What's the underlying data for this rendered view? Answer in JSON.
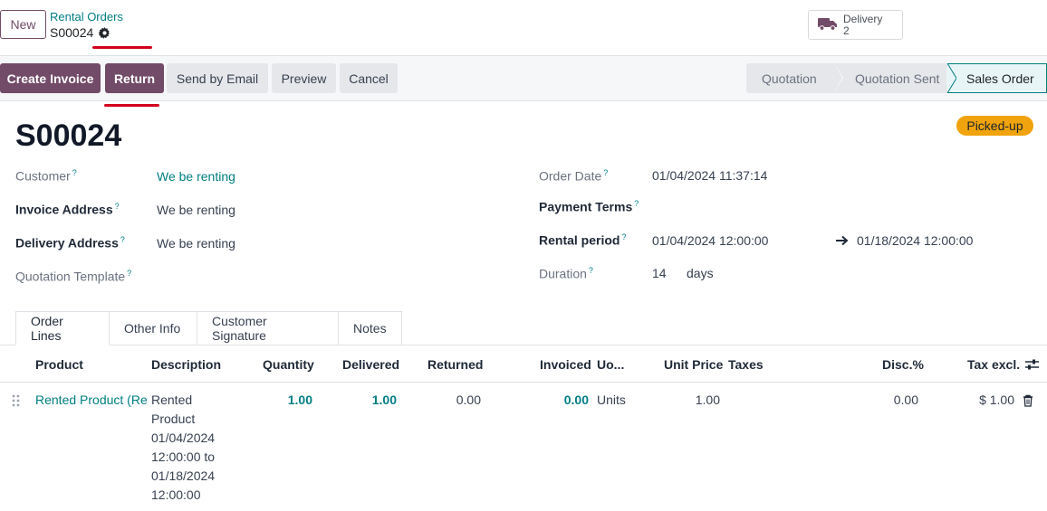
{
  "topbar": {
    "new_label": "New",
    "breadcrumb_parent": "Rental Orders",
    "breadcrumb_current": "S00024",
    "delivery_label": "Delivery",
    "delivery_count": "2"
  },
  "actions": {
    "create_invoice": "Create Invoice",
    "return": "Return",
    "send_by_email": "Send by Email",
    "preview": "Preview",
    "cancel": "Cancel"
  },
  "statusbar": {
    "stages": [
      "Quotation",
      "Quotation Sent",
      "Sales Order"
    ],
    "active": "Sales Order"
  },
  "form": {
    "title": "S00024",
    "badge": "Picked-up",
    "customer_label": "Customer",
    "customer_value": "We be renting",
    "invoice_address_label": "Invoice Address",
    "invoice_address_value": "We be renting",
    "delivery_address_label": "Delivery Address",
    "delivery_address_value": "We be renting",
    "quotation_template_label": "Quotation Template",
    "order_date_label": "Order Date",
    "order_date_value": "01/04/2024 11:37:14",
    "payment_terms_label": "Payment Terms",
    "rental_period_label": "Rental period",
    "rental_start": "01/04/2024 12:00:00",
    "rental_end": "01/18/2024 12:00:00",
    "duration_label": "Duration",
    "duration_value": "14",
    "duration_unit": "days",
    "help_mark": "?"
  },
  "tabs": [
    "Order Lines",
    "Other Info",
    "Customer Signature",
    "Notes"
  ],
  "table": {
    "headers": {
      "product": "Product",
      "description": "Description",
      "quantity": "Quantity",
      "delivered": "Delivered",
      "returned": "Returned",
      "invoiced": "Invoiced",
      "uom": "Uo...",
      "unit_price": "Unit Price",
      "taxes": "Taxes",
      "disc": "Disc.%",
      "tax_excl": "Tax excl."
    },
    "rows": [
      {
        "product": "Rented Product (Rer",
        "description_lines": [
          "Rented",
          "Product",
          "01/04/2024",
          "12:00:00 to",
          "01/18/2024",
          "12:00:00"
        ],
        "quantity": "1.00",
        "delivered": "1.00",
        "returned": "0.00",
        "invoiced": "0.00",
        "uom": "Units",
        "unit_price": "1.00",
        "disc": "0.00",
        "tax_excl": "$ 1.00"
      }
    ]
  },
  "colors": {
    "primary": "#714b67",
    "link": "#017e84",
    "badge": "#f0a30c",
    "annotation": "#d0021b"
  }
}
